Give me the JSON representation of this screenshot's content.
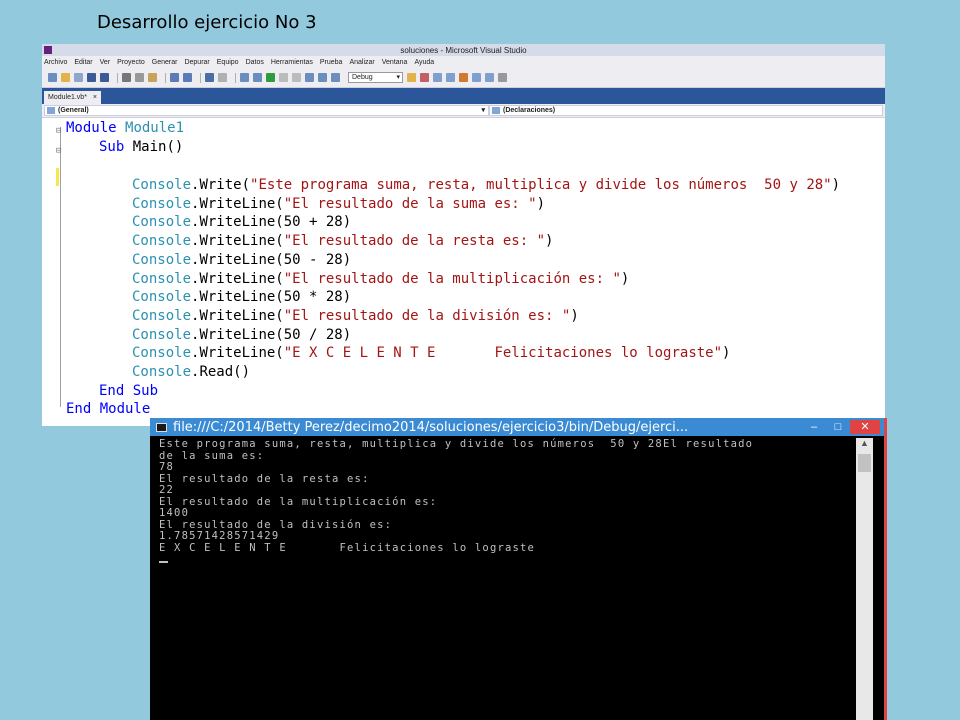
{
  "slide": {
    "title": "Desarrollo ejercicio No 3"
  },
  "vs": {
    "window_title": "soluciones - Microsoft Visual Studio",
    "menu": [
      "Archivo",
      "Editar",
      "Ver",
      "Proyecto",
      "Generar",
      "Depurar",
      "Equipo",
      "Datos",
      "Herramientas",
      "Prueba",
      "Analizar",
      "Ventana",
      "Ayuda"
    ],
    "toolbar": {
      "config_combo": "Debug"
    },
    "tab": {
      "label": "Module1.vb*",
      "close": "×"
    },
    "nav": {
      "left": "(General)",
      "right": "(Declaraciones)"
    }
  },
  "code": {
    "module_kw": "Module",
    "module_name": "Module1",
    "sub_kw": "Sub",
    "sub_name": "Main()",
    "console": "Console",
    "l1_method": ".Write(",
    "l1_str": "\"Este programa suma, resta, multiplica y divide los números  50 y 28\"",
    "l1_end": ")",
    "l2_method": ".WriteLine(",
    "l2_str": "\"El resultado de la suma es: \"",
    "l2_end": ")",
    "l3": ".WriteLine(50 + 28)",
    "l4_method": ".WriteLine(",
    "l4_str": "\"El resultado de la resta es: \"",
    "l4_end": ")",
    "l5": ".WriteLine(50 - 28)",
    "l6_method": ".WriteLine(",
    "l6_str": "\"El resultado de la multiplicación es: \"",
    "l6_end": ")",
    "l7": ".WriteLine(50 * 28)",
    "l8_method": ".WriteLine(",
    "l8_str": "\"El resultado de la división es: \"",
    "l8_end": ")",
    "l9": ".WriteLine(50 / 28)",
    "l10_method": ".WriteLine(",
    "l10_str": "\"E X C E L E N T E       Felicitaciones lo lograste\"",
    "l10_end": ")",
    "l11": ".Read()",
    "end_sub": "End Sub",
    "end_module": "End Module"
  },
  "console_window": {
    "title": "file:///C:/2014/Betty Perez/decimo2014/soluciones/ejercicio3/bin/Debug/ejerci...",
    "btn_min": "–",
    "btn_max": "□",
    "btn_close": "✕",
    "scroll_up": "▲",
    "lines": [
      "Este programa suma, resta, multiplica y divide los números  50 y 28El resultado",
      "de la suma es:",
      "78",
      "El resultado de la resta es:",
      "22",
      "El resultado de la multiplicación es:",
      "1400",
      "El resultado de la división es:",
      "1.78571428571429",
      "E X C E L E N T E       Felicitaciones lo lograste"
    ]
  },
  "colors": {
    "vs_tab_bar": "#2B579A",
    "console_title": "#3A8BD4",
    "keyword": "#0000FF",
    "class": "#2B91AF",
    "string": "#A31515",
    "background": "#92C9DD"
  }
}
